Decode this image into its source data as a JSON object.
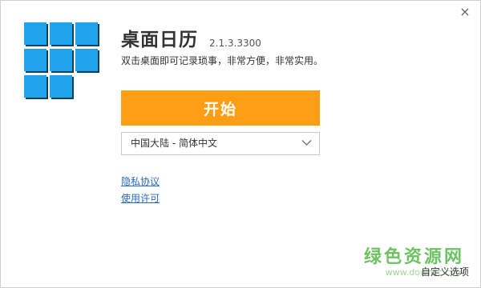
{
  "window": {
    "close_glyph": "×"
  },
  "app": {
    "name": "桌面日历",
    "version": "2.1.3.3300",
    "tagline": "双击桌面即可记录琐事，非常方便，非常实用。",
    "logo_icon": "blue-tile-grid-logo",
    "logo_color": "#1ea3ec"
  },
  "start_button": {
    "label": "开始",
    "color": "#ff9e15"
  },
  "language_select": {
    "selected": "中国大陆 - 简体中文",
    "icon": "chevron-down-icon"
  },
  "links": {
    "privacy": "隐私协议",
    "license": "使用许可"
  },
  "footer": {
    "custom_options": "自定义选项"
  },
  "watermark": {
    "text": "绿色资源网",
    "url": "www.downcc.com"
  }
}
